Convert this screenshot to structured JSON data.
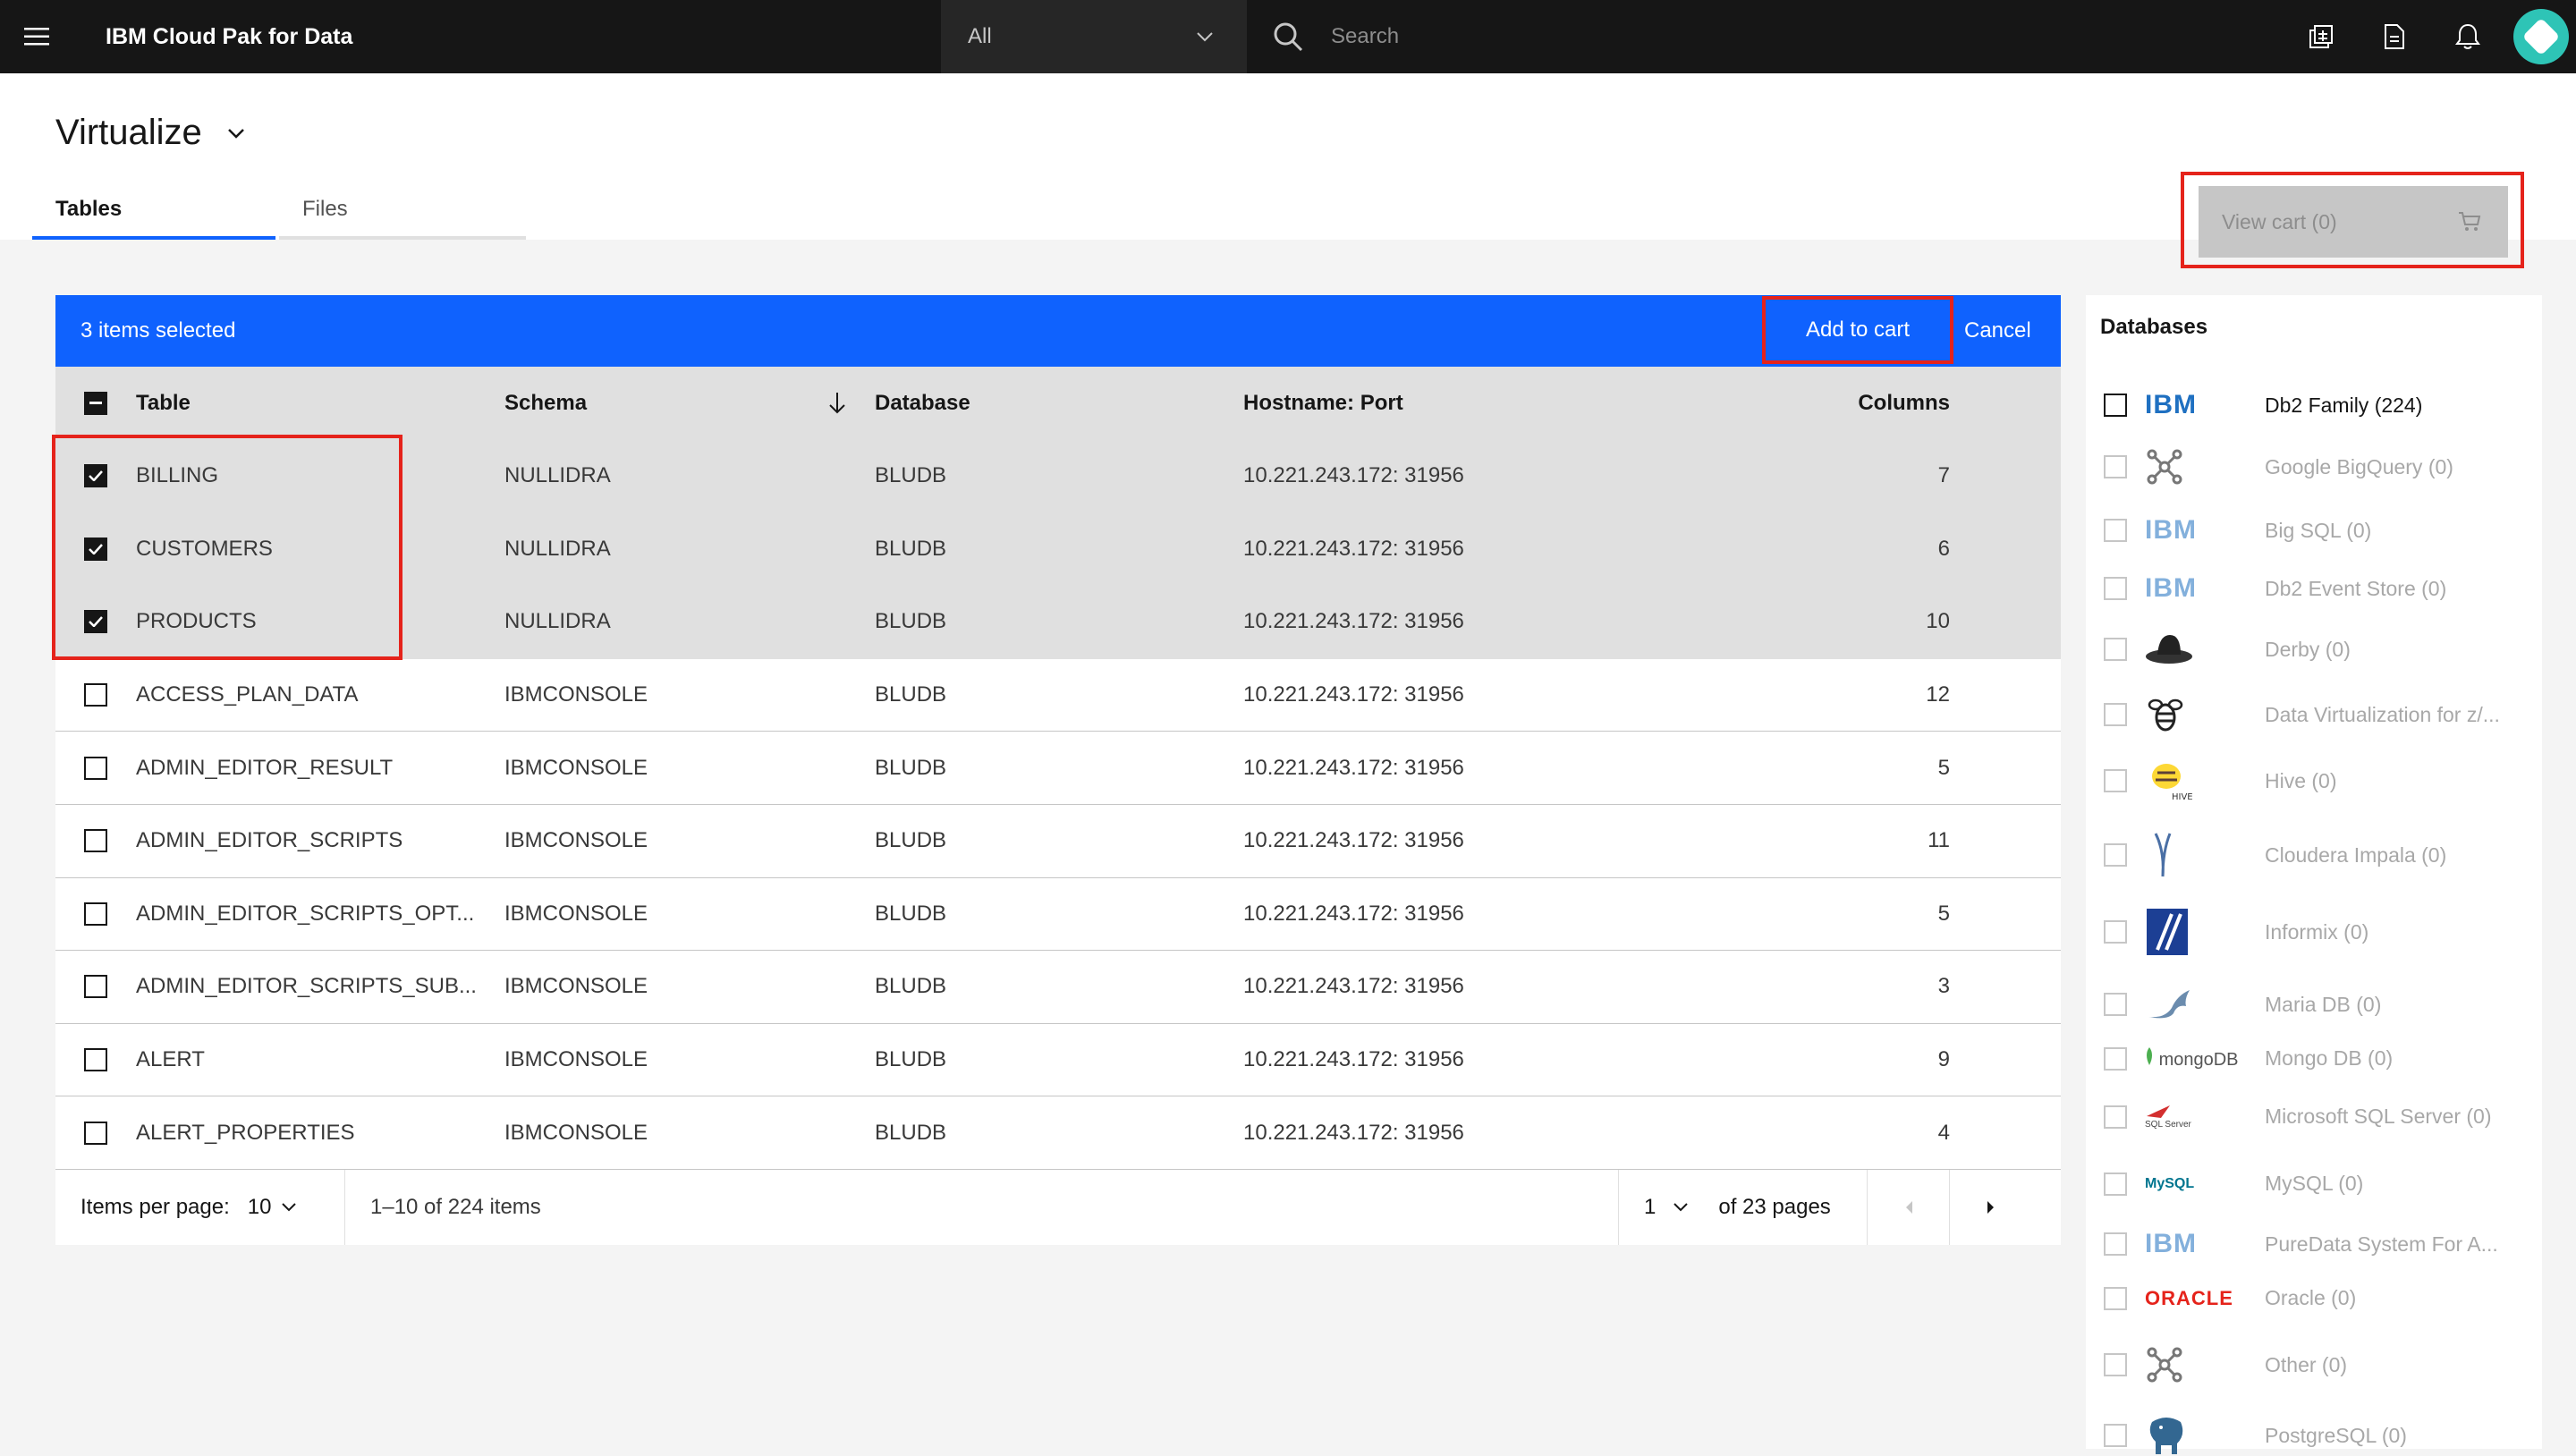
{
  "header": {
    "brand": "IBM Cloud Pak for Data",
    "scope": "All",
    "search_placeholder": "Search"
  },
  "page": {
    "title": "Virtualize",
    "tabs": [
      {
        "label": "Tables",
        "active": true
      },
      {
        "label": "Files",
        "active": false
      }
    ],
    "view_cart": "View cart (0)"
  },
  "batch_bar": {
    "selected_text": "3 items selected",
    "add_to_cart": "Add to cart",
    "cancel": "Cancel"
  },
  "table": {
    "headers": {
      "table": "Table",
      "schema": "Schema",
      "database": "Database",
      "host": "Hostname: Port",
      "columns": "Columns"
    },
    "rows": [
      {
        "table": "BILLING",
        "schema": "NULLIDRA",
        "database": "BLUDB",
        "host": "10.221.243.172: 31956",
        "columns": "7",
        "checked": true
      },
      {
        "table": "CUSTOMERS",
        "schema": "NULLIDRA",
        "database": "BLUDB",
        "host": "10.221.243.172: 31956",
        "columns": "6",
        "checked": true
      },
      {
        "table": "PRODUCTS",
        "schema": "NULLIDRA",
        "database": "BLUDB",
        "host": "10.221.243.172: 31956",
        "columns": "10",
        "checked": true
      },
      {
        "table": "ACCESS_PLAN_DATA",
        "schema": "IBMCONSOLE",
        "database": "BLUDB",
        "host": "10.221.243.172: 31956",
        "columns": "12",
        "checked": false
      },
      {
        "table": "ADMIN_EDITOR_RESULT",
        "schema": "IBMCONSOLE",
        "database": "BLUDB",
        "host": "10.221.243.172: 31956",
        "columns": "5",
        "checked": false
      },
      {
        "table": "ADMIN_EDITOR_SCRIPTS",
        "schema": "IBMCONSOLE",
        "database": "BLUDB",
        "host": "10.221.243.172: 31956",
        "columns": "11",
        "checked": false
      },
      {
        "table": "ADMIN_EDITOR_SCRIPTS_OPT...",
        "schema": "IBMCONSOLE",
        "database": "BLUDB",
        "host": "10.221.243.172: 31956",
        "columns": "5",
        "checked": false
      },
      {
        "table": "ADMIN_EDITOR_SCRIPTS_SUB...",
        "schema": "IBMCONSOLE",
        "database": "BLUDB",
        "host": "10.221.243.172: 31956",
        "columns": "3",
        "checked": false
      },
      {
        "table": "ALERT",
        "schema": "IBMCONSOLE",
        "database": "BLUDB",
        "host": "10.221.243.172: 31956",
        "columns": "9",
        "checked": false
      },
      {
        "table": "ALERT_PROPERTIES",
        "schema": "IBMCONSOLE",
        "database": "BLUDB",
        "host": "10.221.243.172: 31956",
        "columns": "4",
        "checked": false
      }
    ]
  },
  "pagination": {
    "items_per_page_label": "Items per page:",
    "items_per_page": "10",
    "range": "1–10 of 224 items",
    "page": "1",
    "of_pages": "of 23 pages"
  },
  "sidebar": {
    "title": "Databases",
    "items": [
      {
        "label": "Db2 Family (224)",
        "logo": "IBM",
        "active": true
      },
      {
        "label": "Google BigQuery (0)",
        "logo": "bigquery-icon",
        "active": false
      },
      {
        "label": "Big SQL (0)",
        "logo": "IBM",
        "active": false
      },
      {
        "label": "Db2 Event Store (0)",
        "logo": "IBM",
        "active": false
      },
      {
        "label": "Derby (0)",
        "logo": "derby-hat-icon",
        "active": false
      },
      {
        "label": "Data Virtualization for z/...",
        "logo": "bee-icon",
        "active": false
      },
      {
        "label": "Hive (0)",
        "logo": "hive-icon",
        "active": false
      },
      {
        "label": "Cloudera Impala (0)",
        "logo": "impala-icon",
        "active": false
      },
      {
        "label": "Informix (0)",
        "logo": "informix-icon",
        "active": false
      },
      {
        "label": "Maria DB (0)",
        "logo": "mariadb-seal-icon",
        "active": false
      },
      {
        "label": "Mongo DB (0)",
        "logo": "mongoDB",
        "active": false
      },
      {
        "label": "Microsoft SQL Server (0)",
        "logo": "SQL Server",
        "active": false
      },
      {
        "label": "MySQL (0)",
        "logo": "MySQL",
        "active": false
      },
      {
        "label": "PureData System For A...",
        "logo": "IBM",
        "active": false
      },
      {
        "label": "Oracle (0)",
        "logo": "ORACLE",
        "active": false
      },
      {
        "label": "Other (0)",
        "logo": "other-network-icon",
        "active": false
      },
      {
        "label": "PostgreSQL (0)",
        "logo": "postgres-elephant-icon",
        "active": false
      }
    ]
  },
  "colors": {
    "primary": "#0f62fe",
    "header": "#161616",
    "highlight": "#e5231b"
  }
}
